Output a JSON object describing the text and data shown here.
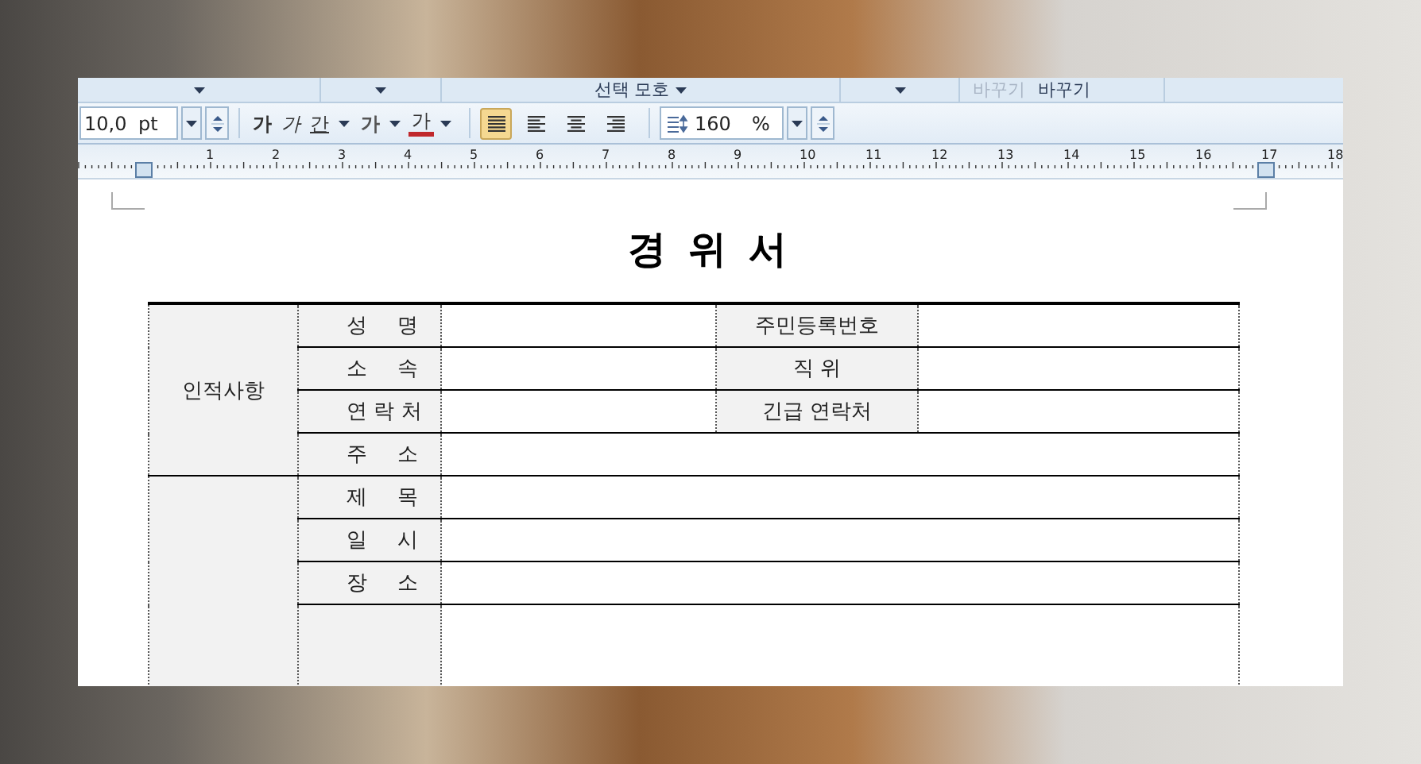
{
  "top_toolbar": {
    "selection_label": "선택 모호",
    "replace_buttons": [
      {
        "label": "바꾸기",
        "disabled": true
      },
      {
        "label": "바꾸기",
        "disabled": false
      }
    ]
  },
  "format_toolbar": {
    "font_size": {
      "value": "10,0",
      "unit": "pt"
    },
    "char_buttons": [
      {
        "kind": "bold",
        "label": "가"
      },
      {
        "kind": "italic",
        "label": "가"
      },
      {
        "kind": "underline",
        "label": "간"
      },
      {
        "kind": "outline",
        "label": "가"
      },
      {
        "kind": "color",
        "label": "가"
      }
    ],
    "align_buttons": [
      {
        "kind": "justify",
        "selected": true
      },
      {
        "kind": "left",
        "selected": false
      },
      {
        "kind": "center",
        "selected": false
      },
      {
        "kind": "right",
        "selected": false
      }
    ],
    "line_spacing": {
      "value": "160",
      "unit": "%"
    }
  },
  "ruler": {
    "labels": [
      "1",
      "2",
      "3",
      "4",
      "5",
      "6",
      "7",
      "8",
      "9",
      "10",
      "11",
      "12",
      "13",
      "14",
      "15",
      "16",
      "17",
      "18"
    ]
  },
  "document": {
    "title": "경 위 서",
    "sections": [
      {
        "heading": "인적사항",
        "rows": [
          {
            "label": "성 명",
            "side_label": "주민등록번호"
          },
          {
            "label": "소 속",
            "side_label": "직 위"
          },
          {
            "label": "연 락 처",
            "side_label": "긴급 연락처"
          },
          {
            "label": "주 소"
          }
        ]
      },
      {
        "rows": [
          {
            "label": "제 목"
          },
          {
            "label": "일 시"
          },
          {
            "label": "장 소"
          },
          {
            "kind": "blank"
          }
        ]
      }
    ]
  }
}
